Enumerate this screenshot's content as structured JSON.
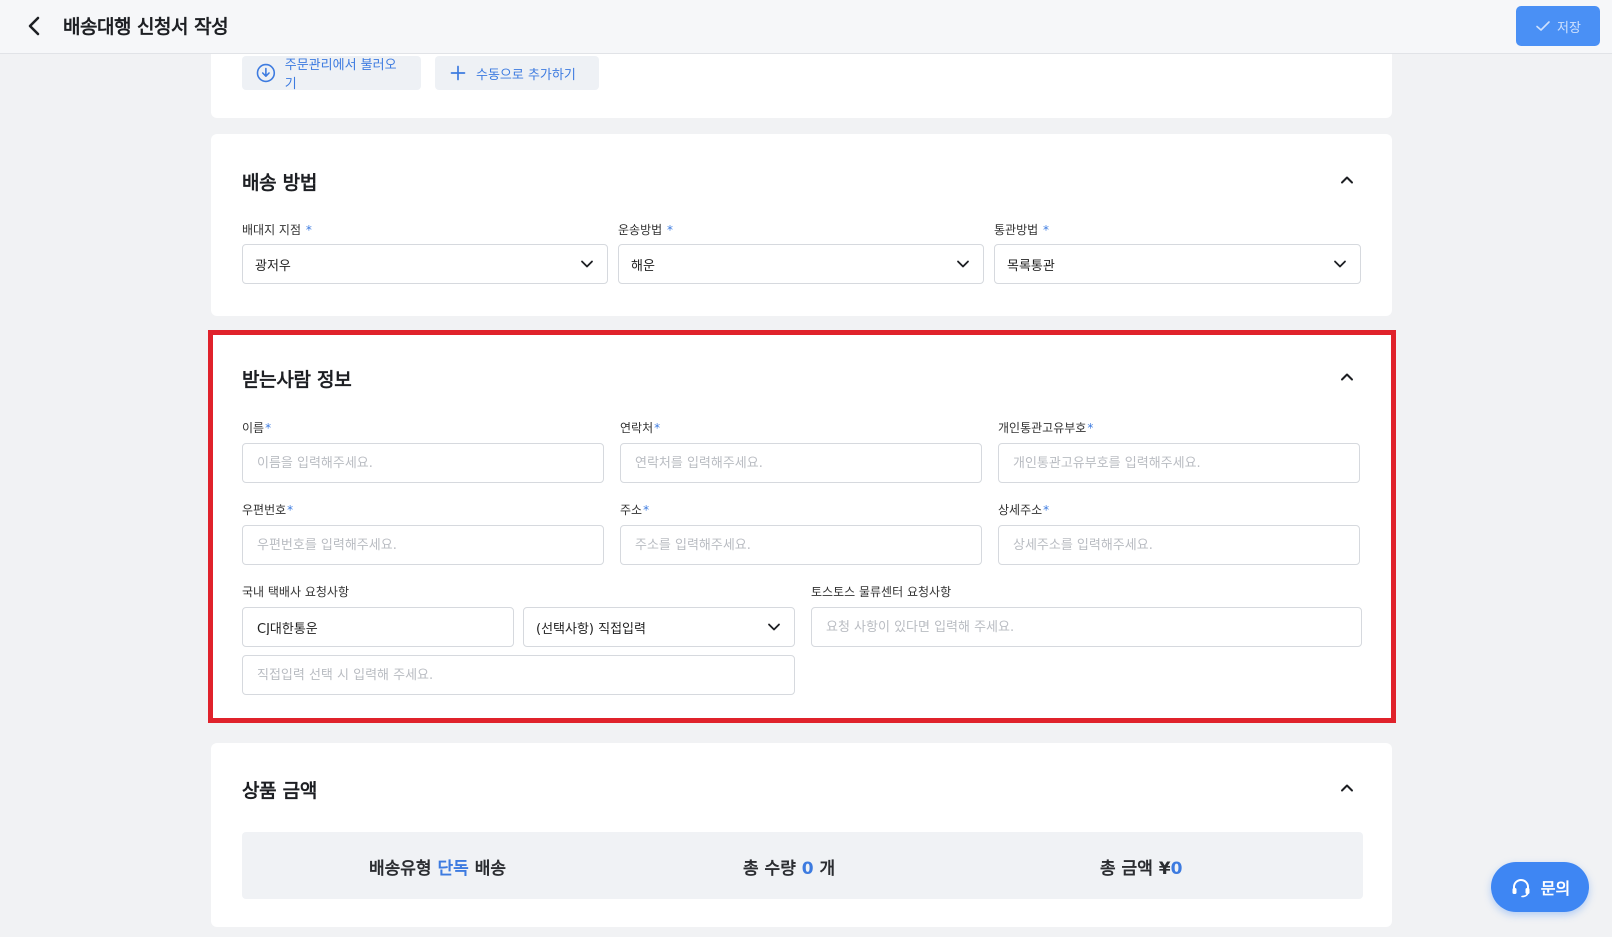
{
  "header": {
    "title": "배송대행 신청서 작성",
    "save_label": "저장"
  },
  "top_actions": {
    "import_label": "주문관리에서 불러오기",
    "manual_add_label": "수동으로 추가하기"
  },
  "shipping": {
    "title": "배송 방법",
    "fields": [
      {
        "label": "배대지 지점",
        "value": "광저우"
      },
      {
        "label": "운송방법",
        "value": "해운"
      },
      {
        "label": "통관방법",
        "value": "목록통관"
      }
    ]
  },
  "recipient": {
    "title": "받는사람 정보",
    "name": {
      "label": "이름",
      "placeholder": "이름을 입력해주세요."
    },
    "phone": {
      "label": "연락처",
      "placeholder": "연락처를 입력해주세요."
    },
    "customs_id": {
      "label": "개인통관고유부호",
      "placeholder": "개인통관고유부호를 입력해주세요."
    },
    "zip": {
      "label": "우편번호",
      "placeholder": "우편번호를 입력해주세요."
    },
    "address": {
      "label": "주소",
      "placeholder": "주소를 입력해주세요."
    },
    "address_detail": {
      "label": "상세주소",
      "placeholder": "상세주소를 입력해주세요."
    },
    "courier_request": {
      "label": "국내 택배사 요청사항",
      "courier_value": "CJ대한통운",
      "option_value": "(선택사항) 직접입력",
      "direct_placeholder": "직접입력 선택 시 입력해 주세요."
    },
    "center_request": {
      "label": "토스토스 물류센터 요청사항",
      "placeholder": "요청 사항이 있다면 입력해 주세요."
    }
  },
  "amount": {
    "title": "상품 금액",
    "shipping_type_prefix": "배송유형",
    "shipping_type_value": "단독",
    "shipping_type_suffix": "배송",
    "quantity_prefix": "총 수량",
    "quantity_value": "0",
    "quantity_suffix": "개",
    "total_prefix": "총 금액",
    "total_currency": "¥",
    "total_value": "0"
  },
  "chat": {
    "label": "문의"
  },
  "colors": {
    "accent": "#3d7be0",
    "highlight": "#e0222b",
    "primary_button": "#4a90f5"
  }
}
